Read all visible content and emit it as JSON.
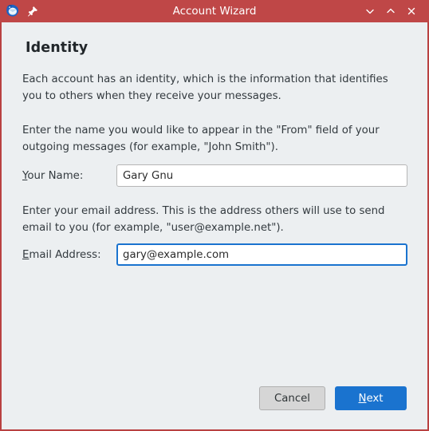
{
  "window": {
    "title": "Account Wizard",
    "titlebar_color": "#bf4747",
    "border_color": "#b94141",
    "background_color": "#eceff1",
    "icons": {
      "app": "thunderbird-icon",
      "pin": "pin-icon",
      "minimize": "chevron-down-icon",
      "maximize": "chevron-up-icon",
      "close": "close-icon"
    }
  },
  "content": {
    "heading": "Identity",
    "paragraph_1": "Each account has an identity, which is the information that identifies you to others when they receive your messages.",
    "paragraph_2": "Enter the name you would like to appear in the \"From\" field of your outgoing messages (for example, \"John Smith\").",
    "paragraph_3": "Enter your email address. This is the address others will use to send email to you (for example, \"user@example.net\").",
    "fields": {
      "name": {
        "label_mnemonic": "Y",
        "label_rest": "our Name:",
        "value": "Gary Gnu",
        "placeholder": "",
        "focused": false
      },
      "email": {
        "label_mnemonic": "E",
        "label_rest": "mail Address:",
        "value": "gary@example.com",
        "placeholder": "",
        "focused": true,
        "focus_color": "#1a73cf"
      }
    }
  },
  "footer": {
    "cancel_label": "Cancel",
    "next_mnemonic": "N",
    "next_rest": "ext",
    "next_color": "#1a73cf"
  }
}
